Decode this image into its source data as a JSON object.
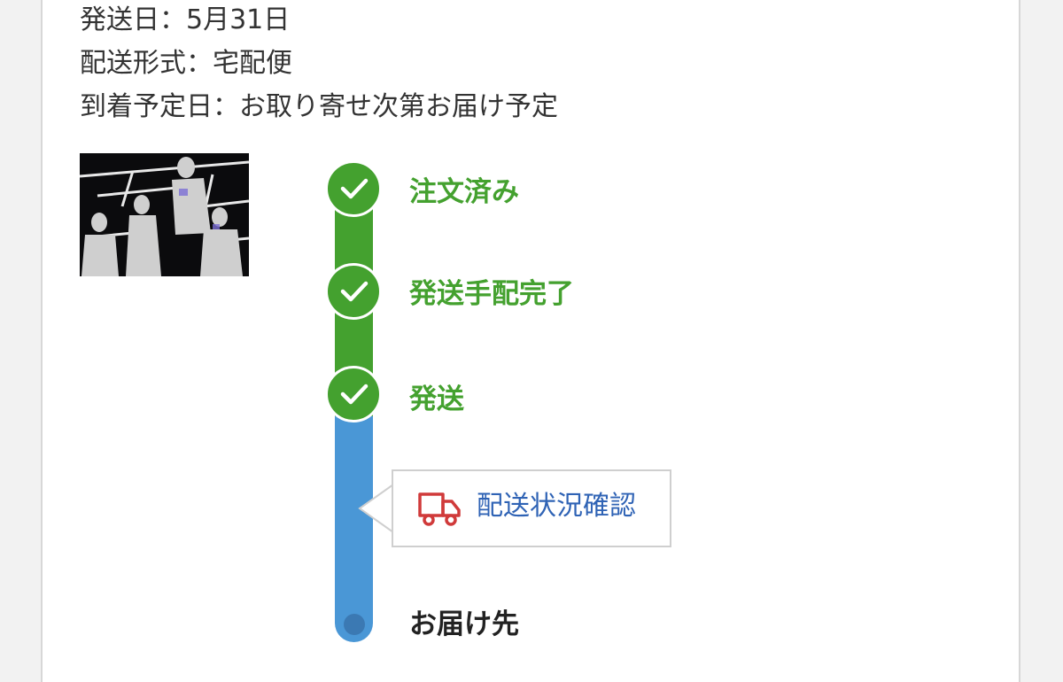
{
  "order_info": {
    "ship_date": "発送日：5月31日",
    "delivery_method": "配送形式：宅配便",
    "arrival_date": "到着予定日：お取り寄せ次第お届け予定"
  },
  "progress": {
    "steps": [
      {
        "label": "注文済み",
        "status": "complete"
      },
      {
        "label": "発送手配完了",
        "status": "complete"
      },
      {
        "label": "発送",
        "status": "complete"
      },
      {
        "label": "お届け先",
        "status": "pending"
      }
    ],
    "tracking_link": {
      "label": "配送状況確認",
      "icon": "truck-icon"
    }
  },
  "colors": {
    "complete": "#44a12f",
    "in_transit": "#4a97d6",
    "link": "#2f63b5",
    "truck_icon": "#d03a3a"
  }
}
